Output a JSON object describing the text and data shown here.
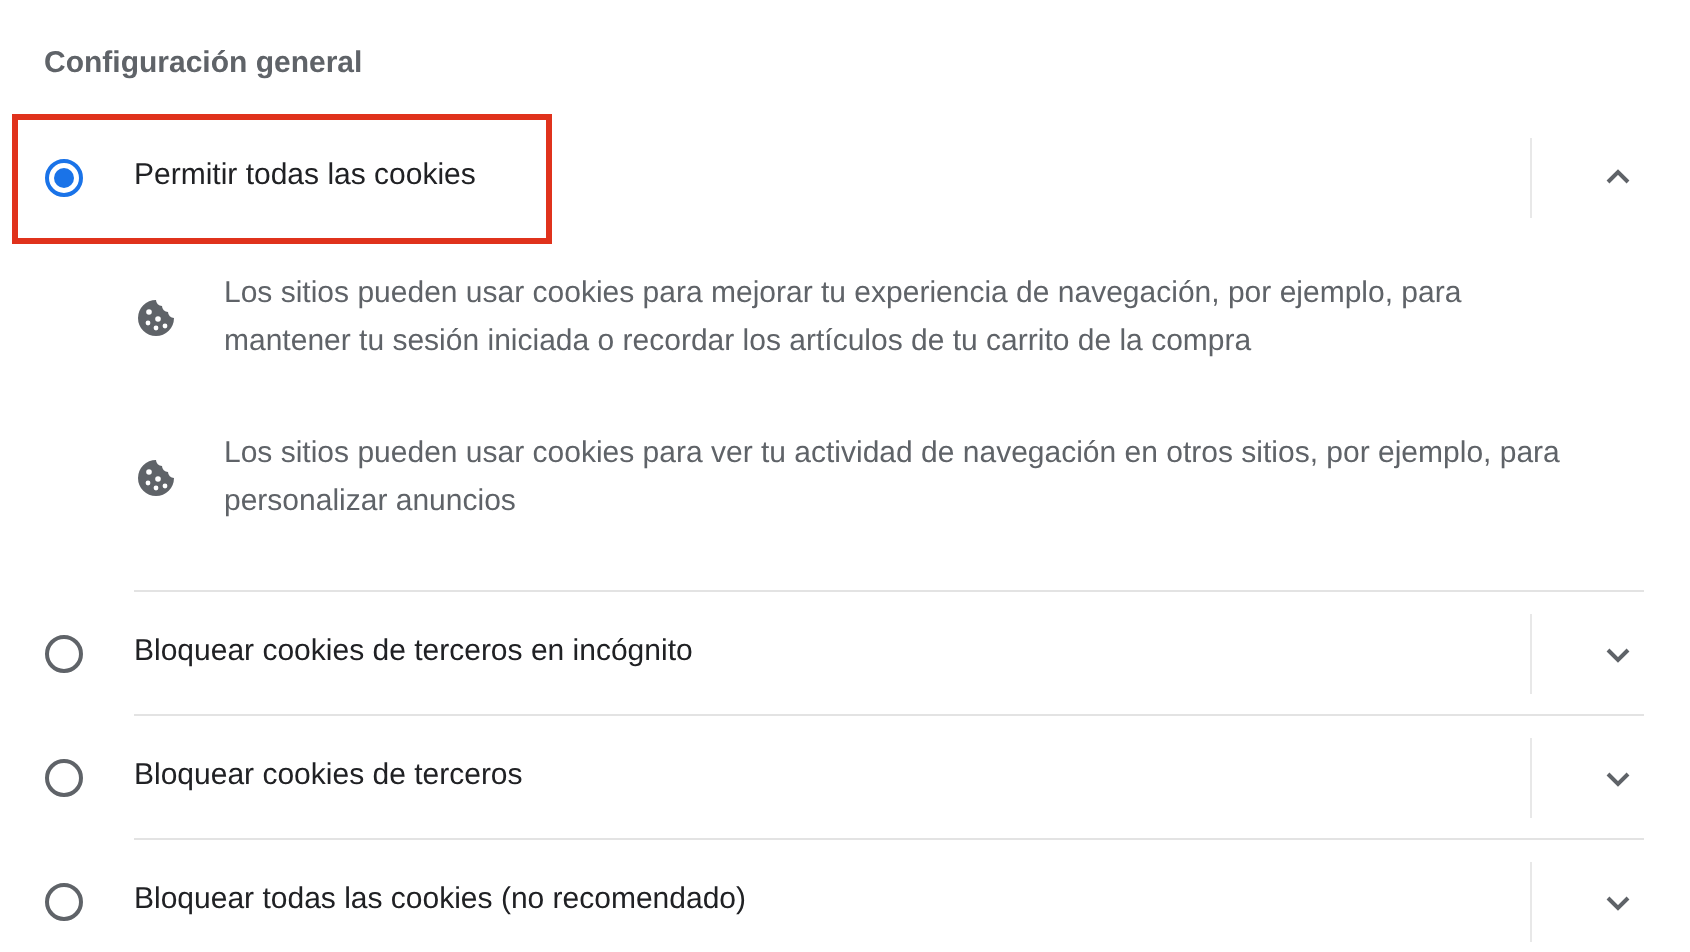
{
  "section_title": "Configuración general",
  "options": [
    {
      "label": "Permitir todas las cookies",
      "selected": true,
      "expanded": true,
      "highlighted": true,
      "details": [
        "Los sitios pueden usar cookies para mejorar tu experiencia de navegación, por ejemplo, para mantener tu sesión iniciada o recordar los artículos de tu carrito de la compra",
        "Los sitios pueden usar cookies para ver tu actividad de navegación en otros sitios, por ejemplo, para personalizar anuncios"
      ]
    },
    {
      "label": "Bloquear cookies de terceros en incógnito",
      "selected": false,
      "expanded": false,
      "highlighted": false
    },
    {
      "label": "Bloquear cookies de terceros",
      "selected": false,
      "expanded": false,
      "highlighted": false
    },
    {
      "label": "Bloquear todas las cookies (no recomendado)",
      "selected": false,
      "expanded": false,
      "highlighted": false
    }
  ]
}
